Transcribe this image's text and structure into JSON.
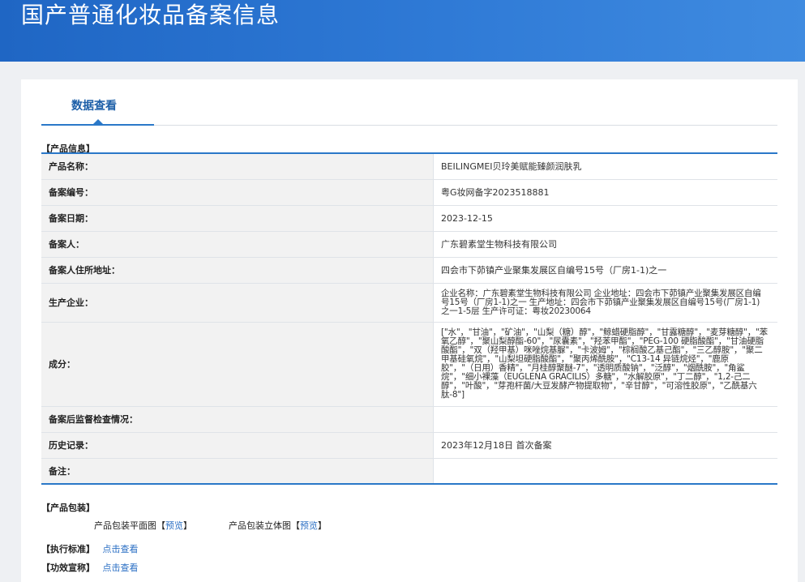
{
  "header": {
    "title": "国产普通化妆品备案信息"
  },
  "tabs": [
    {
      "label": "数据查看"
    }
  ],
  "sections": {
    "product_info": "【产品信息】",
    "packaging": "【产品包装】",
    "standard": "【执行标准】",
    "efficacy": "【功效宣称】"
  },
  "product_rows": [
    {
      "label": "产品名称：",
      "value": "BEILINGMEI贝玲美赋能臻颜润肤乳"
    },
    {
      "label": "备案编号：",
      "value": "粤G妆网备字2023518881"
    },
    {
      "label": "备案日期：",
      "value": "2023-12-15"
    },
    {
      "label": "备案人：",
      "value": "广东碧素堂生物科技有限公司"
    },
    {
      "label": "备案人住所地址：",
      "value": "四会市下茆镇产业聚集发展区自编号15号（厂房1-1)之一"
    },
    {
      "label": "生产企业：",
      "value": "企业名称：广东碧素堂生物科技有限公司 企业地址：四会市下茆镇产业聚集发展区自编号15号（厂房1-1)之一 生产地址：四会市下茆镇产业聚集发展区自编号15号(厂房1-1)之一1-5层 生产许可证：粤妆20230064"
    },
    {
      "label": "成分：",
      "value": "[\"水\"，\"甘油\"，\"矿油\"，\"山梨（糖）醇\"，\"鲸蜡硬脂醇\"，\"甘露糖醇\"，\"麦芽糖醇\"，\"苯氧乙醇\"，\"聚山梨醇酯-60\"，\"尿囊素\"，\"羟苯甲酯\"，\"PEG-100 硬脂酸酯\"，\"甘油硬脂酸酯\"，\"双（羟甲基）咪唑烷基脲\"，\"卡波姆\"，\"棕榈酸乙基己酯\"，\"三乙醇胺\"，\"聚二甲基硅氧烷\"，\"山梨坦硬脂酸酯\"，\"聚丙烯酰胺\"，\"C13-14 异链烷烃\"，\"鹿原胶\"，\"（日用）香精\"，\"月桂醇聚醚-7\"，\"透明质酸钠\"，\"泛醇\"，\"烟酰胺\"，\"角鲨烷\"，\"细小裸藻（EUGLENA GRACILIS）多糖\"，\"水解胶原\"，\"丁二醇\"，\"1,2-己二醇\"，\"叶酸\"，\"芽孢杆菌/大豆发酵产物提取物\"，\"辛甘醇\"，\"可溶性胶原\"，\"乙酰基六肽-8\"]"
    },
    {
      "label": "备案后监督检查情况：",
      "value": ""
    },
    {
      "label": "历史记录：",
      "value": "2023年12月18日 首次备案"
    },
    {
      "label": "备注：",
      "value": ""
    }
  ],
  "packaging": {
    "flat_label": "产品包装平面图",
    "flat_link": "预览",
    "stereo_label": "产品包装立体图",
    "stereo_link": "预览",
    "bracket_open": "【",
    "bracket_close": "】"
  },
  "standard_link": "点击查看",
  "efficacy_link": "点击查看"
}
